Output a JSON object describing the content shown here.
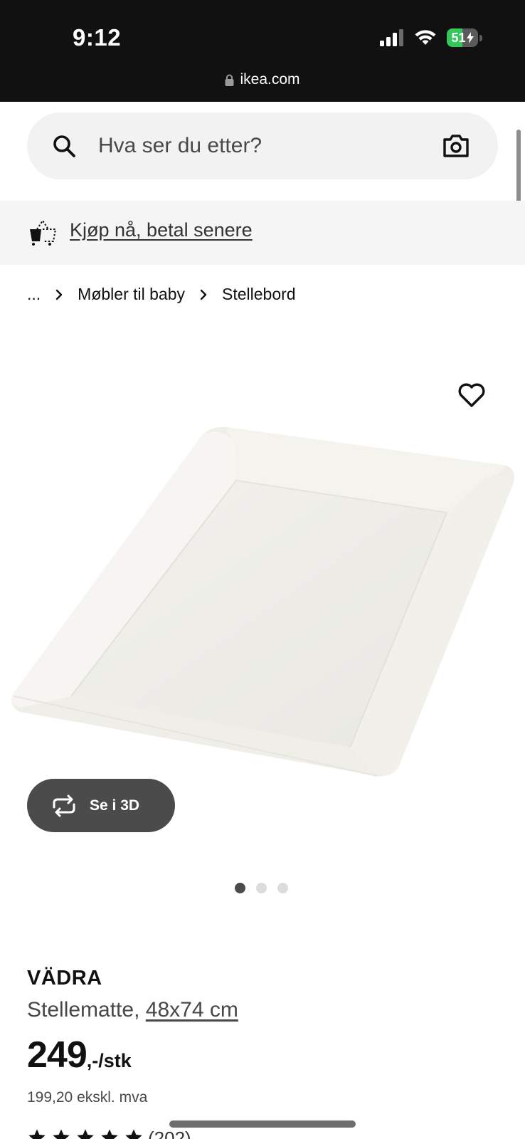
{
  "status_bar": {
    "time": "9:12",
    "battery_level": "51",
    "battery_fraction": 0.51,
    "battery_color": "#34c759"
  },
  "browser": {
    "url": "ikea.com"
  },
  "search": {
    "placeholder": "Hva ser du etter?",
    "left_icon": "search-icon",
    "right_icon": "camera-icon"
  },
  "promo": {
    "icon": "basket-icon",
    "link_text": "Kjøp nå, betal senere"
  },
  "breadcrumb": {
    "items": [
      "...",
      "Møbler til baby",
      "Stellebord"
    ]
  },
  "product": {
    "fav_icon": "heart-icon",
    "view_3d_label": "Se i 3D",
    "image_count": 3,
    "active_image_index": 0,
    "name": "VÄDRA",
    "description": "Stellematte,",
    "size_link": "48x74 cm",
    "price": "249",
    "price_suffix": ",-/stk",
    "price_ex_vat": "199,20 ekskl. mva",
    "review_count": "(202)"
  },
  "colors": {
    "status_bar_bg": "#111111",
    "search_bg": "#f2f2f2",
    "button_dark": "#4b4b4b",
    "promo_bg": "#f5f5f5"
  }
}
